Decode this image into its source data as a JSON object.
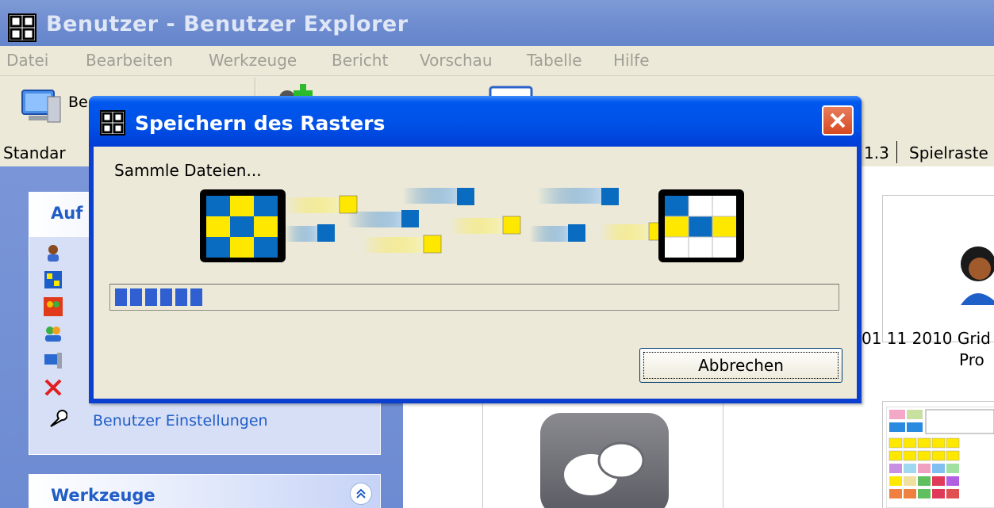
{
  "window": {
    "title": "Benutzer - Benutzer Explorer"
  },
  "menu": [
    "Datei",
    "Bearbeiten",
    "Werkzeuge",
    "Bericht",
    "Vorschau",
    "Tabelle",
    "Hilfe"
  ],
  "toolbar": {
    "first_label_partial": "Be"
  },
  "tabs": {
    "left_partial": "Standar",
    "right_partial_a": "1.3",
    "right_partial_b": "Spielraste"
  },
  "left_pane": {
    "panel1_title_partial": "Auf",
    "panel1_link": "Benutzer Einstellungen",
    "panel2_title": "Werkzeuge",
    "collapse_glyph": "«"
  },
  "content": {
    "card_caption_line1": "01 11 2010 Grid",
    "card_caption_line2": "Pro"
  },
  "dialog": {
    "title": "Speichern des Rasters",
    "status": "Sammle Dateien...",
    "progress_blocks": 6,
    "cancel_label": "Abbrechen"
  },
  "colors": {
    "xp_blue": "#0050e6",
    "progress": "#2f5fd0",
    "grid_yellow": "#ffe800",
    "grid_blue": "#0a6cc0"
  }
}
